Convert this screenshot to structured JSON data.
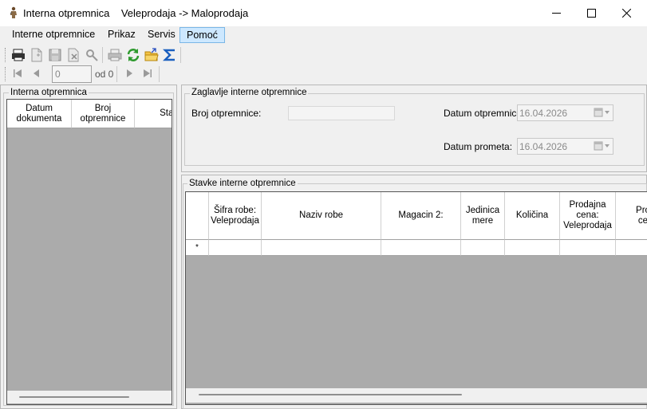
{
  "window": {
    "title": "Interna otpremnica    Veleprodaja -> Maloprodaja",
    "app_icon": "man-figure-icon",
    "controls": {
      "minimize": "—",
      "maximize": "☐",
      "close": "✕"
    }
  },
  "menu": {
    "items": [
      {
        "label": "Interne otpremnice",
        "active": false
      },
      {
        "label": "Prikaz",
        "active": false
      },
      {
        "label": "Servis",
        "active": false
      },
      {
        "label": "Pomoć",
        "active": true
      }
    ]
  },
  "toolbar": {
    "icons": [
      "print-preview-icon",
      "new-document-icon",
      "save-icon",
      "delete-icon",
      "search-key-icon",
      "print-icon",
      "refresh-icon",
      "open-folder-icon",
      "sum-icon"
    ]
  },
  "navigator": {
    "position_value": "0",
    "of_label": "od 0"
  },
  "left_panel": {
    "title": "Interna otpremnica",
    "columns": [
      "Datum dokumenta",
      "Broj otpremnice",
      "Statu"
    ]
  },
  "header_section": {
    "title": "Zaglavlje interne otpremnice",
    "broj_label": "Broj otpremnice:",
    "broj_value": "",
    "datum_otpremnice_label": "Datum otpremnice:",
    "datum_otpremnice_value": "16.04.2026",
    "datum_prometa_label": "Datum prometa:",
    "datum_prometa_value": "16.04.2026"
  },
  "items_section": {
    "title": "Stavke interne otpremnice",
    "columns": [
      "Šifra robe: Veleprodaja",
      "Naziv robe",
      "Magacin 2:",
      "Jedinica mere",
      "Količina",
      "Prodajna cena: Veleprodaja",
      "Pro ce"
    ],
    "new_row_marker": "*"
  },
  "colors": {
    "grid_background": "#ababab",
    "active_menu": "#cde8ff",
    "window_background": "#f0f0f0"
  }
}
